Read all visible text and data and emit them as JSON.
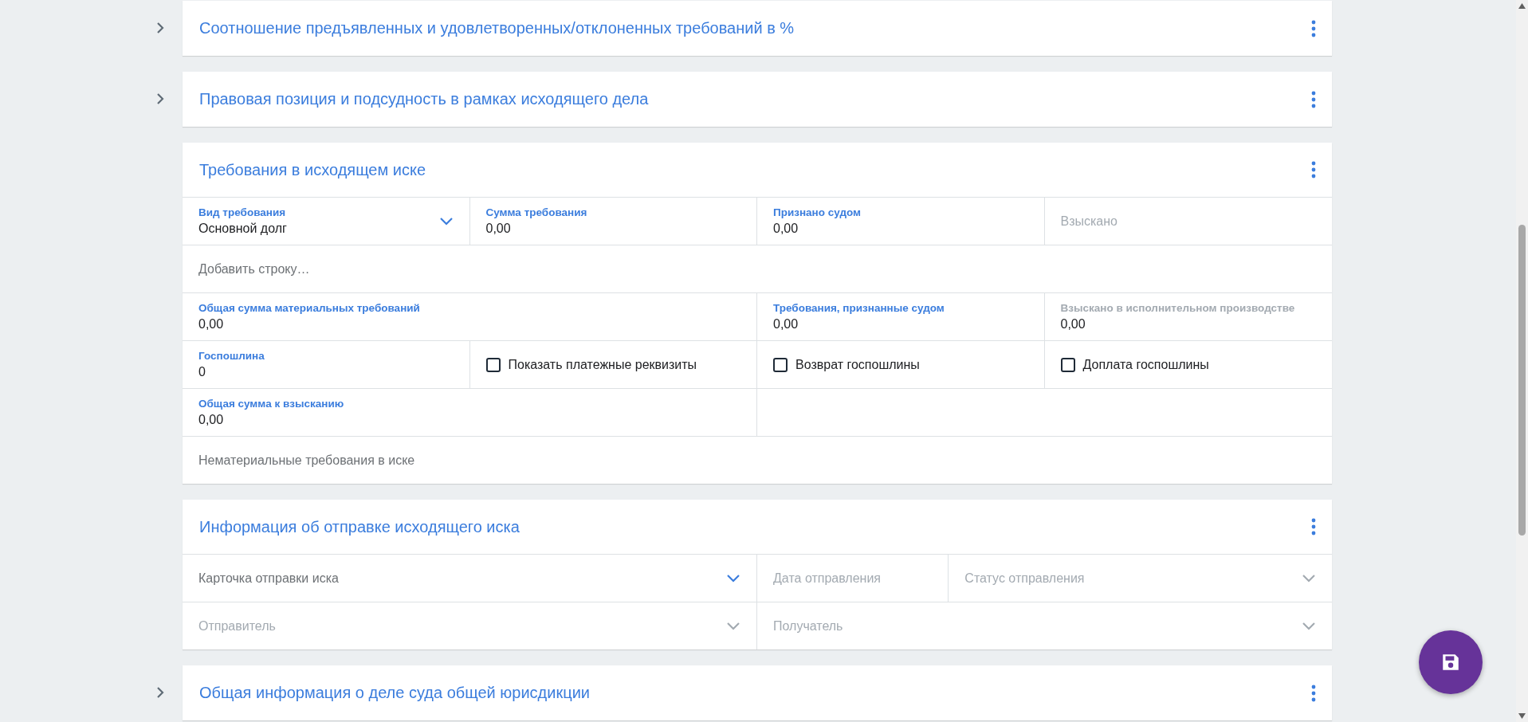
{
  "sections": [
    {
      "title": "Соотношение предъявленных и удовлетворенных/отклоненных требований в %",
      "expanded": false
    },
    {
      "title": "Правовая позиция и подсудность в рамках исходящего дела",
      "expanded": false
    },
    {
      "title": "Требования в исходящем иске",
      "expanded": true,
      "field_groups": [
        {
          "kind": "quarters",
          "fields": [
            {
              "kind": "select",
              "label": "Вид требования",
              "value": "Основной долг",
              "disabled": false
            },
            {
              "kind": "value",
              "label": "Сумма требования",
              "value": "0,00",
              "disabled": false
            },
            {
              "kind": "value",
              "label": "Признано судом",
              "value": "0,00",
              "disabled": false
            },
            {
              "kind": "text",
              "placeholder": "Взыскано",
              "disabled": true
            }
          ]
        },
        {
          "kind": "full",
          "fields": [
            {
              "kind": "text",
              "placeholder": "Добавить строку…",
              "disabled": false
            }
          ]
        },
        {
          "kind": "half-quarters",
          "fields": [
            {
              "kind": "value",
              "label": "Общая сумма материальных требований",
              "value": "0,00",
              "disabled": false
            },
            {
              "kind": "value",
              "label": "Требования, признанные судом",
              "value": "0,00",
              "disabled": false
            },
            {
              "kind": "value",
              "label": "Взыскано в исполнительном производстве",
              "value": "0,00",
              "disabled": true
            }
          ]
        },
        {
          "kind": "quarters",
          "fields": [
            {
              "kind": "value",
              "label": "Госпошлина",
              "value": "0",
              "disabled": false
            },
            {
              "kind": "checkbox",
              "label": "Показать платежные реквизиты",
              "checked": false
            },
            {
              "kind": "checkbox",
              "label": "Возврат госпошлины",
              "checked": false
            },
            {
              "kind": "checkbox",
              "label": "Доплата госпошлины",
              "checked": false
            }
          ]
        },
        {
          "kind": "halves",
          "fields": [
            {
              "kind": "value",
              "label": "Общая сумма к взысканию",
              "value": "0,00",
              "disabled": false
            },
            {
              "kind": "empty"
            }
          ]
        },
        {
          "kind": "full",
          "fields": [
            {
              "kind": "text",
              "placeholder": "Нематериальные требования в иске",
              "disabled": false
            }
          ]
        }
      ]
    },
    {
      "title": "Информация об отправке исходящего иска",
      "expanded": true,
      "field_groups": [
        {
          "kind": "half-narrow-wide",
          "fields": [
            {
              "kind": "select",
              "placeholder": "Карточка отправки иска",
              "disabled": false
            },
            {
              "kind": "text",
              "placeholder": "Дата отправления",
              "disabled": true
            },
            {
              "kind": "select",
              "placeholder": "Статус отправления",
              "disabled": true
            }
          ]
        },
        {
          "kind": "halves",
          "fields": [
            {
              "kind": "select",
              "placeholder": "Отправитель",
              "disabled": true
            },
            {
              "kind": "select",
              "placeholder": "Получатель",
              "disabled": true
            }
          ]
        }
      ]
    },
    {
      "title": "Общая информация о деле суда общей юрисдикции",
      "expanded": false
    }
  ]
}
